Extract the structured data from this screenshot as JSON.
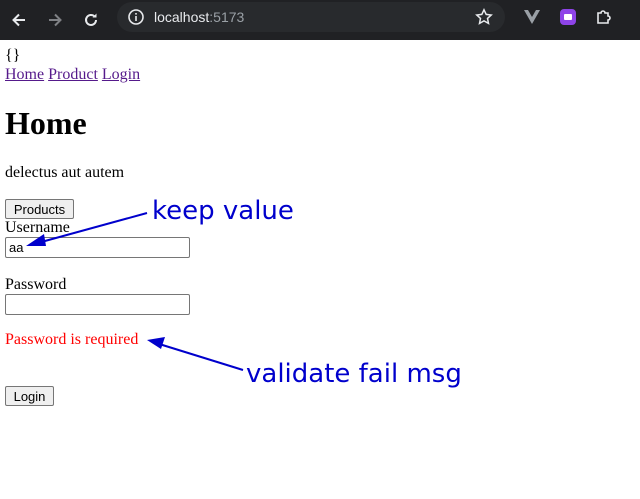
{
  "browser": {
    "url_host": "localhost",
    "url_port": ":5173",
    "icons": {
      "back": "back-arrow-icon",
      "forward": "forward-arrow-icon",
      "reload": "reload-icon",
      "info": "site-info-icon",
      "bookmark": "star-icon",
      "ext1": "vue-devtools-icon",
      "ext2": "extension-icon",
      "ext3": "puzzle-icon"
    }
  },
  "page": {
    "braces": "{}",
    "nav": [
      "Home",
      "Product",
      "Login"
    ],
    "heading": "Home",
    "paragraph": "delectus aut autem",
    "products_button": "Products",
    "username_label": "Username",
    "username_value": "aa",
    "password_label": "Password",
    "password_value": "",
    "error_message": "Password is required",
    "login_button": "Login"
  },
  "annotations": {
    "keep_value": "keep value",
    "validate_fail": "validate fail msg",
    "color": "#0000cc"
  },
  "colors": {
    "toolbar_bg": "#202124",
    "link": "#551a8b",
    "error": "#ff0000"
  }
}
